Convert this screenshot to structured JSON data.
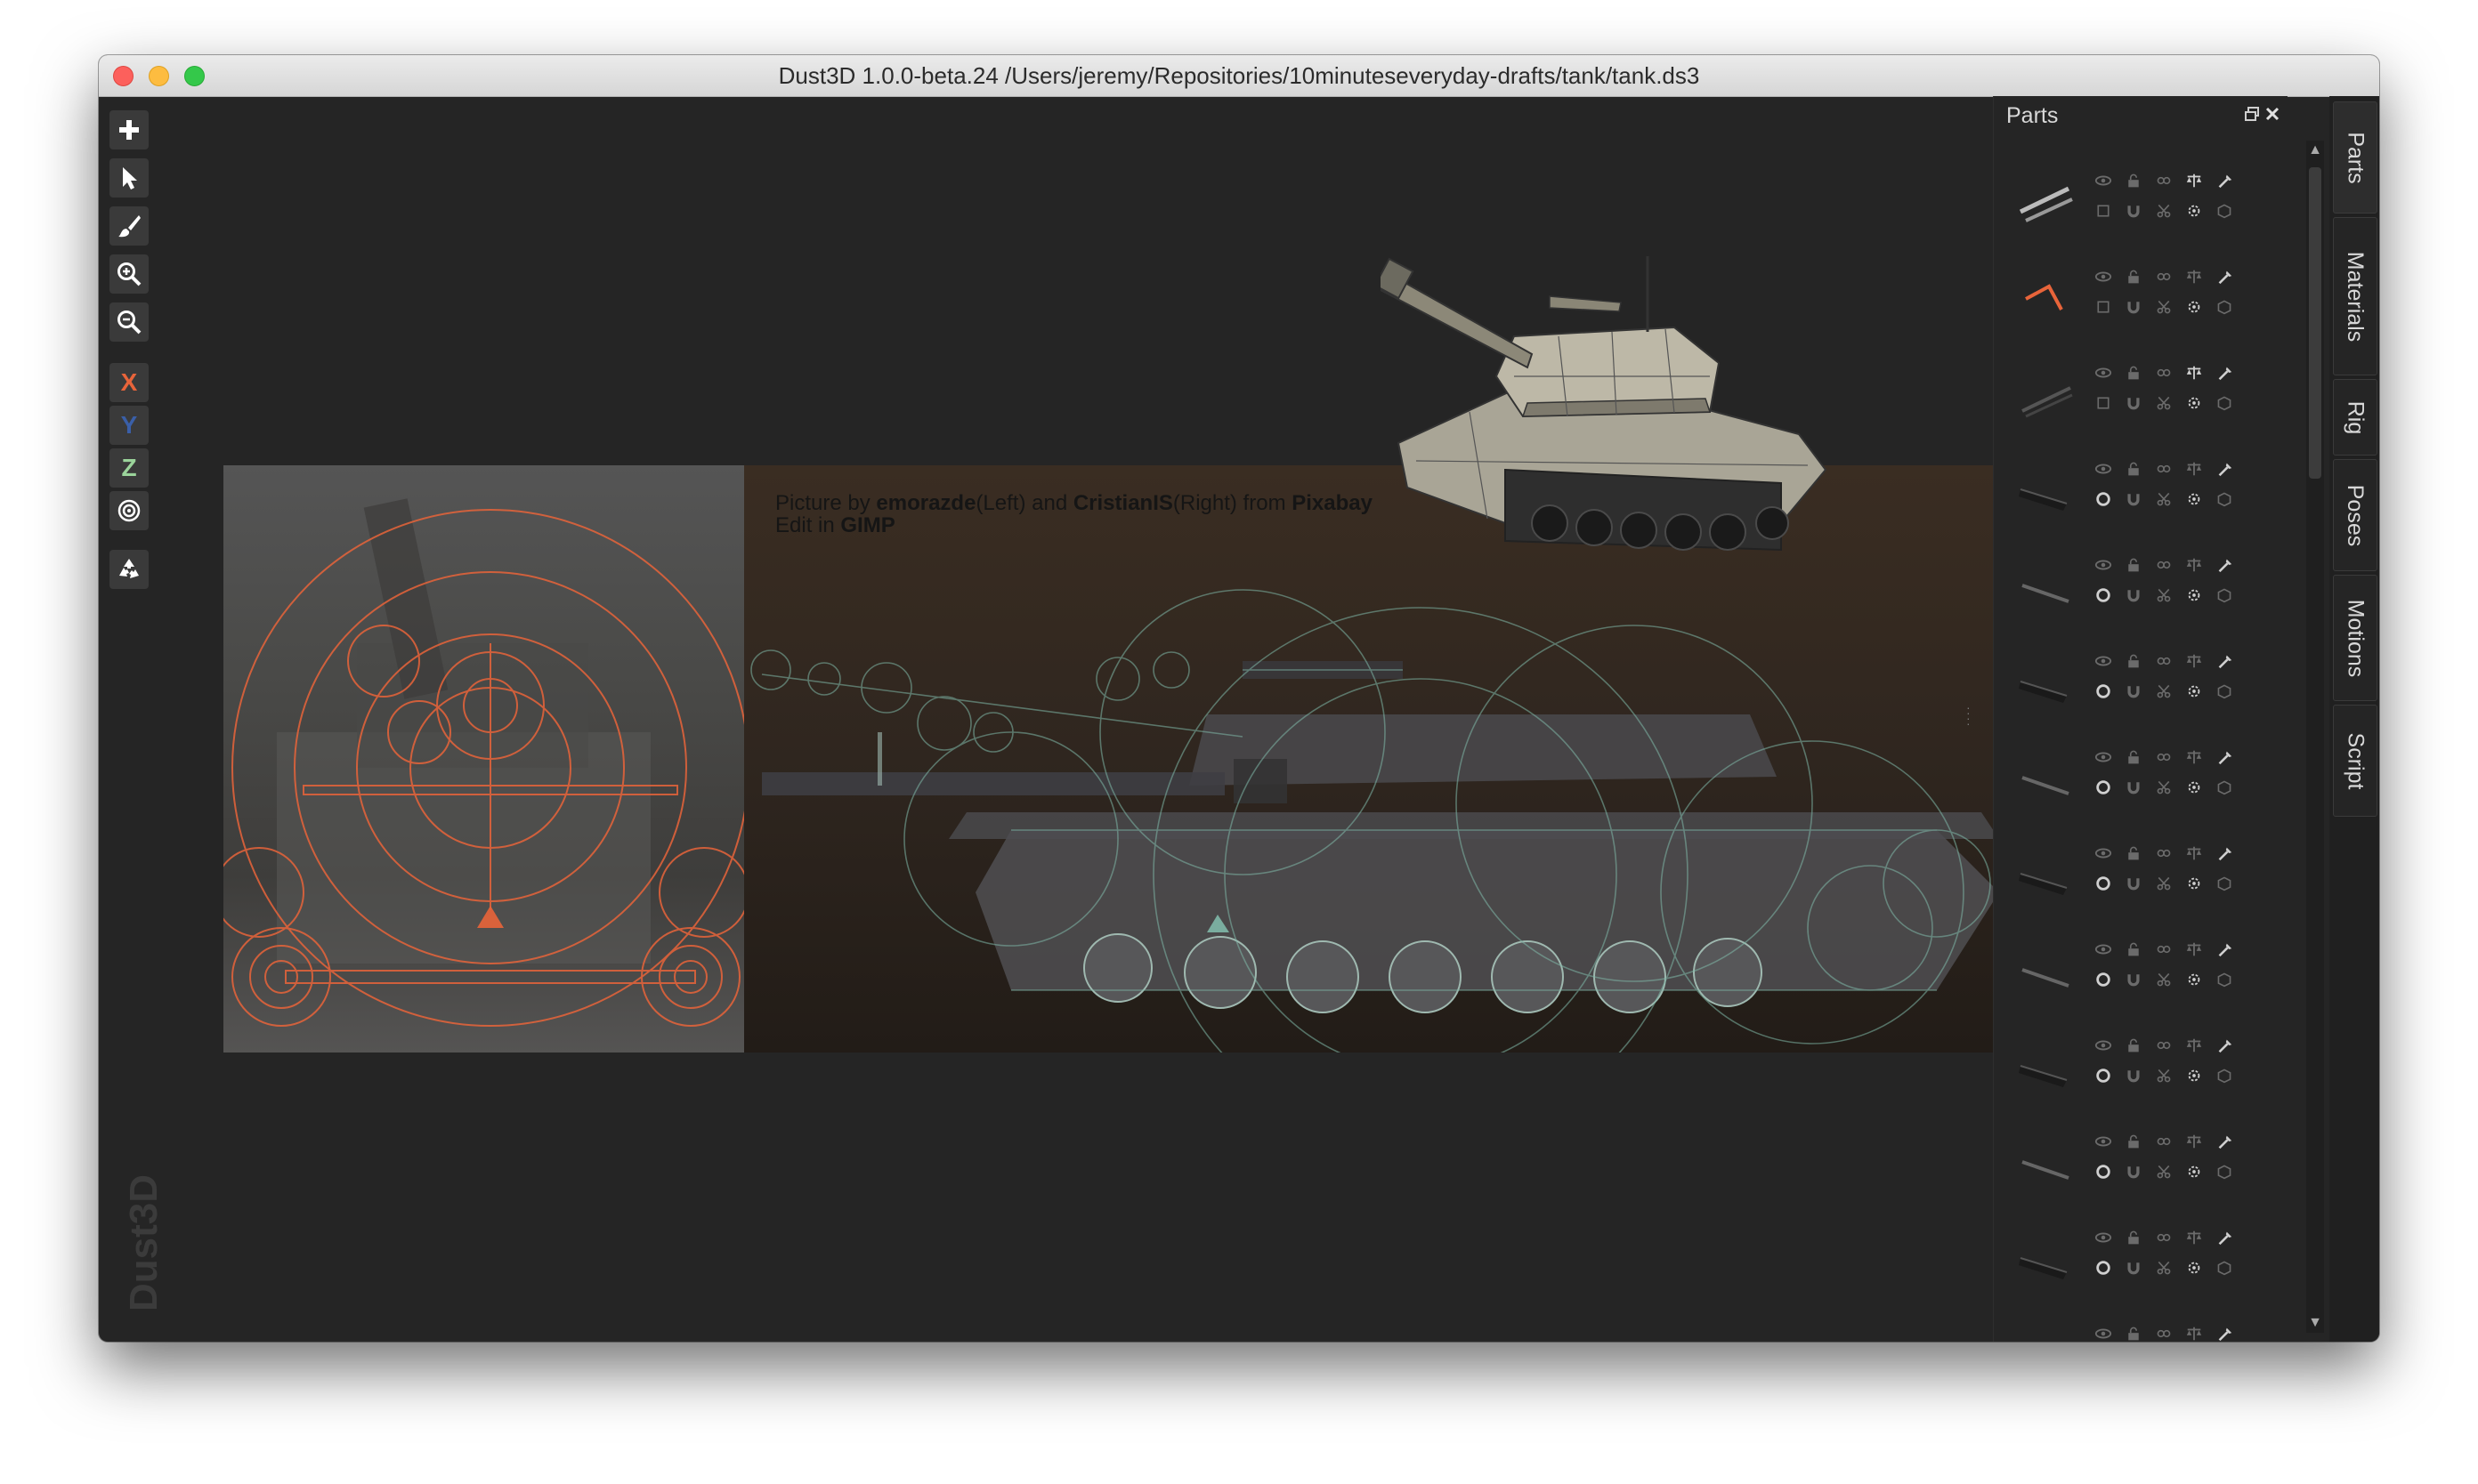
{
  "window": {
    "title": "Dust3D 1.0.0-beta.24 /Users/jeremy/Repositories/10minuteseveryday-drafts/tank/tank.ds3"
  },
  "toolbar": {
    "items": [
      {
        "name": "add",
        "icon": "plus-icon"
      },
      {
        "name": "select",
        "icon": "cursor-icon"
      },
      {
        "name": "paint",
        "icon": "brush-icon"
      },
      {
        "name": "zoom-in",
        "icon": "zoom-in-icon"
      },
      {
        "name": "zoom-out",
        "icon": "zoom-out-icon"
      },
      {
        "name": "x-lock",
        "label": "X",
        "color": "#e8643a"
      },
      {
        "name": "y-lock",
        "label": "Y",
        "color": "#3a5fa8"
      },
      {
        "name": "z-lock",
        "label": "Z",
        "color": "#9bd49b"
      },
      {
        "name": "radius-lock",
        "icon": "target-icon"
      },
      {
        "name": "regenerate",
        "icon": "recycle-icon"
      }
    ],
    "x_label": "X",
    "y_label": "Y",
    "z_label": "Z"
  },
  "watermark": "Dust3D",
  "reference": {
    "credit_line1_prefix": "Picture by ",
    "credit_author1": "emorazde",
    "credit_mid1": "(Left) and ",
    "credit_author2": "CristianIS",
    "credit_mid2": "(Right) from ",
    "credit_source": "Pixabay",
    "credit_line2_prefix": "Edit in ",
    "credit_tool": "GIMP"
  },
  "parts_panel": {
    "title": "Parts",
    "restore_icon": "restore-icon",
    "close_icon": "close-icon"
  },
  "side_tabs": [
    "Parts",
    "Materials",
    "Rig",
    "Poses",
    "Motions",
    "Script"
  ],
  "colors": {
    "orange_accent": "#e8643a",
    "teal_guides": "#7fb8a8"
  }
}
